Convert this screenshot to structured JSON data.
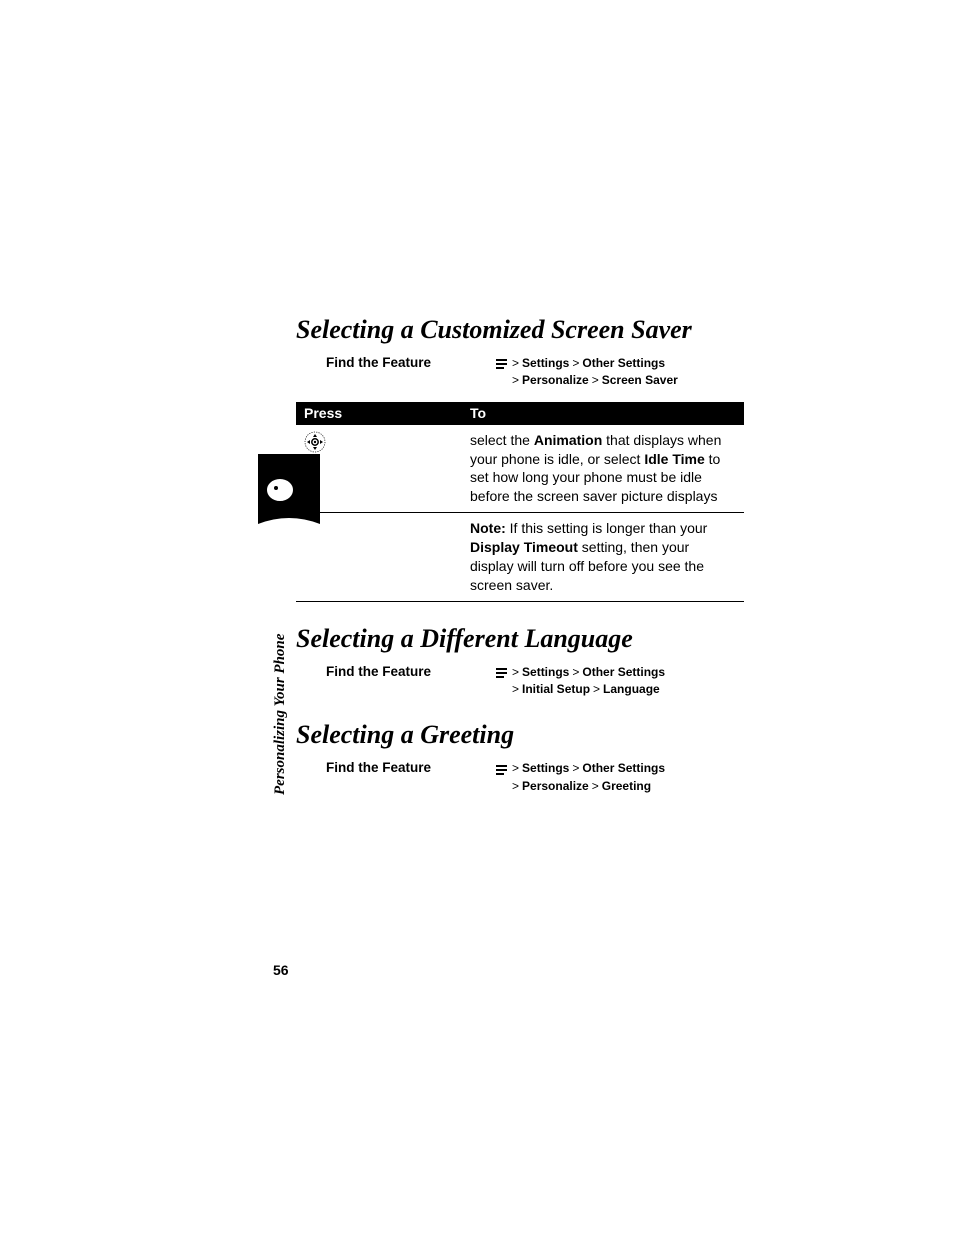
{
  "sideLabel": "Personalizing Your Phone",
  "pageNumber": "56",
  "sections": {
    "screenSaver": {
      "heading": "Selecting a Customized Screen Saver",
      "findLabel": "Find the Feature",
      "path1_a": "Settings",
      "path1_b": "Other Settings",
      "path2_a": "Personalize",
      "path2_b": "Screen Saver",
      "table": {
        "hdrPress": "Press",
        "hdrTo": "To",
        "r1_pre": "select the ",
        "r1_anim": "Animation",
        "r1_mid": " that displays when your phone is idle, or select ",
        "r1_idle": "Idle Time",
        "r1_post": " to set how long your phone must be idle before the screen saver picture displays",
        "r2_noteLabel": "Note:",
        "r2_pre": " If this setting is longer than your ",
        "r2_dto": "Display Timeout",
        "r2_post": " setting, then your display will turn off before you see the screen saver."
      }
    },
    "language": {
      "heading": "Selecting a Different Language",
      "findLabel": "Find the Feature",
      "path1_a": "Settings",
      "path1_b": "Other Settings",
      "path2_a": "Initial Setup",
      "path2_b": "Language"
    },
    "greeting": {
      "heading": "Selecting a Greeting",
      "findLabel": "Find the Feature",
      "path1_a": "Settings",
      "path1_b": "Other Settings",
      "path2_a": "Personalize",
      "path2_b": "Greeting"
    }
  }
}
